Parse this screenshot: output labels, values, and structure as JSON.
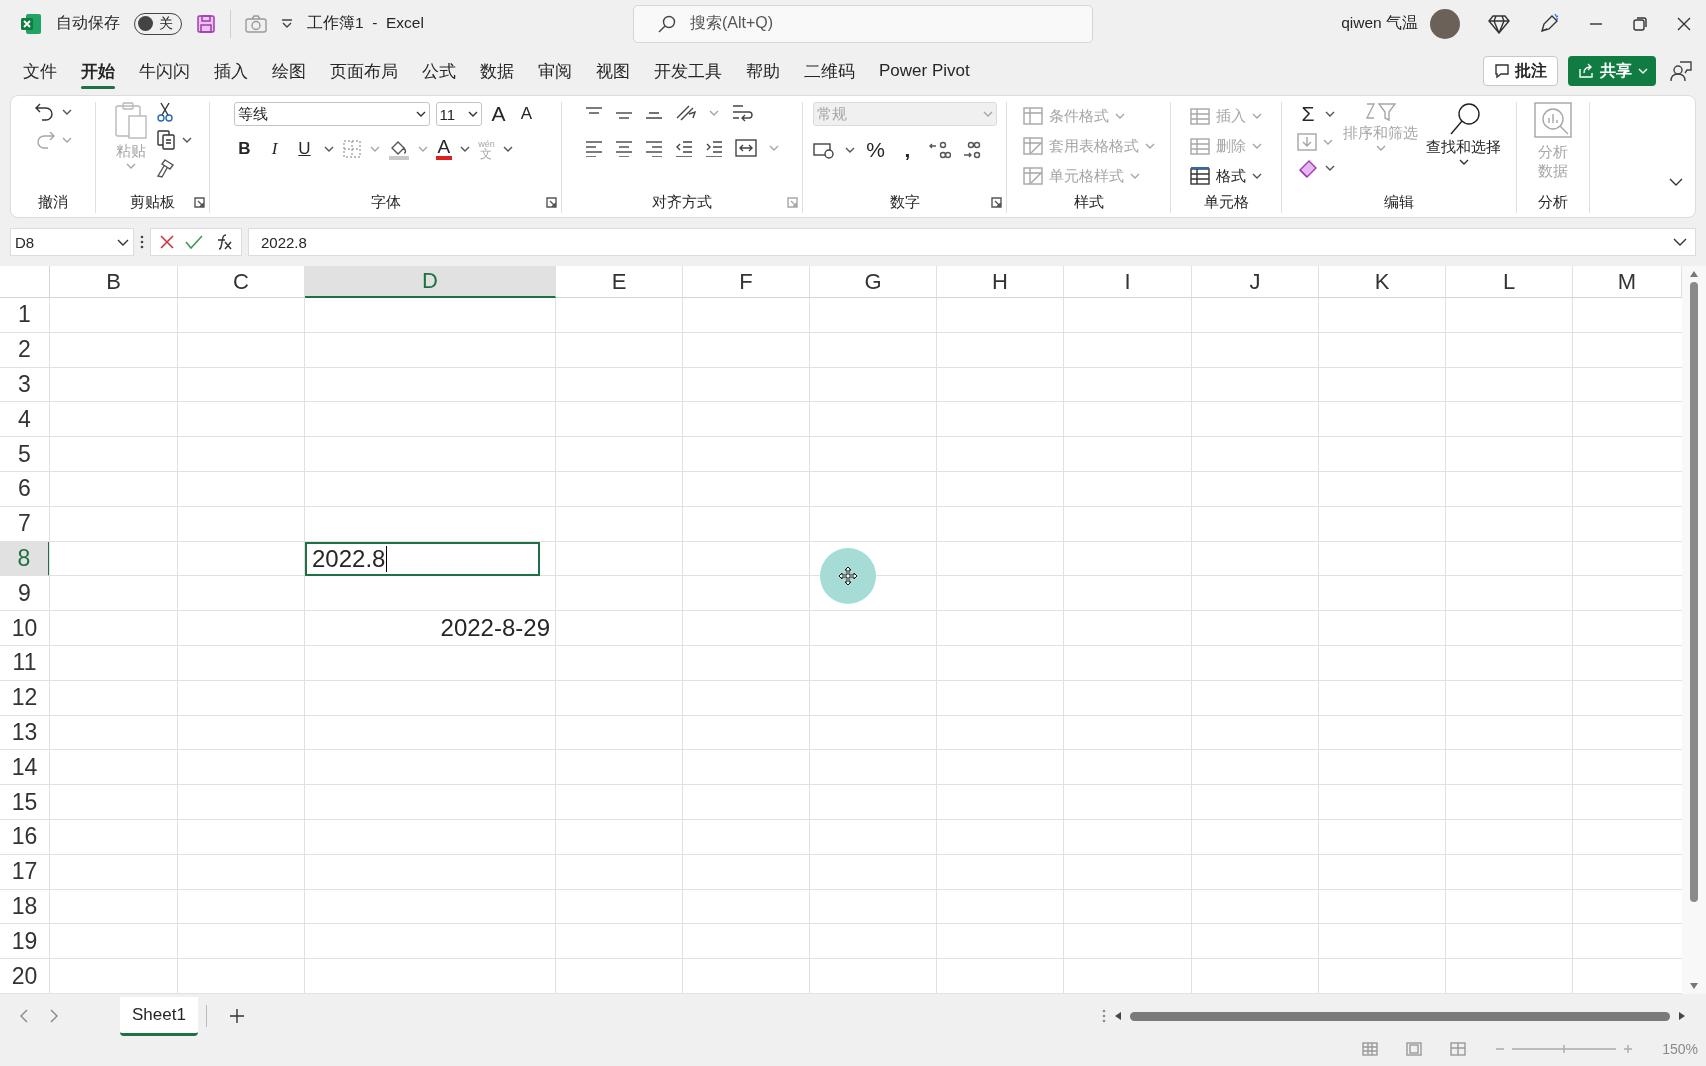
{
  "title_bar": {
    "autosave_label": "自动保存",
    "autosave": {
      "label": "关",
      "on": false
    },
    "document_title": "工作簿1  -  Excel",
    "search": {
      "placeholder": "搜索(Alt+Q)"
    },
    "user_name": "qiwen 气温"
  },
  "ribbon_tabs": [
    {
      "label": "文件",
      "selected": false
    },
    {
      "label": "开始",
      "selected": true
    },
    {
      "label": "牛闪闪",
      "selected": false
    },
    {
      "label": "插入",
      "selected": false
    },
    {
      "label": "绘图",
      "selected": false
    },
    {
      "label": "页面布局",
      "selected": false
    },
    {
      "label": "公式",
      "selected": false
    },
    {
      "label": "数据",
      "selected": false
    },
    {
      "label": "审阅",
      "selected": false
    },
    {
      "label": "视图",
      "selected": false
    },
    {
      "label": "开发工具",
      "selected": false
    },
    {
      "label": "帮助",
      "selected": false
    },
    {
      "label": "二维码",
      "selected": false
    },
    {
      "label": "Power Pivot",
      "selected": false
    }
  ],
  "comments_button": "批注",
  "share_button": "共享",
  "ribbon_groups": [
    {
      "kind": "undo",
      "title": "撤消"
    },
    {
      "kind": "clipboard",
      "title": "剪贴板",
      "launcher": true,
      "paste": {
        "label": "粘贴",
        "disabled": true
      }
    },
    {
      "kind": "font",
      "title": "字体",
      "launcher": true,
      "font_name": "等线",
      "font_size": "11",
      "grow_font": "A",
      "shrink_font": "A",
      "bold": "B",
      "italic": "I",
      "underline": "U",
      "font_color": "A",
      "phonetic": [
        "wén",
        "文"
      ]
    },
    {
      "kind": "alignment",
      "title": "对齐方式",
      "launcher": true
    },
    {
      "kind": "number",
      "title": "数字",
      "launcher": true,
      "number_format": {
        "value": "常规",
        "disabled": true
      },
      "percent": "%",
      "comma": ","
    },
    {
      "kind": "styles",
      "title": "样式",
      "items": [
        {
          "label": "条件格式",
          "disabled": true
        },
        {
          "label": "套用表格格式",
          "disabled": true
        },
        {
          "label": "单元格样式",
          "disabled": true
        }
      ]
    },
    {
      "kind": "cells",
      "title": "单元格",
      "items": [
        {
          "label": "插入",
          "disabled": true
        },
        {
          "label": "删除",
          "disabled": true
        },
        {
          "label": "格式",
          "disabled": false
        }
      ]
    },
    {
      "kind": "editing",
      "title": "编辑",
      "autosum": "Σ",
      "items": [
        {
          "label": "排序和筛选",
          "disabled": true
        },
        {
          "label": "查找和选择",
          "disabled": false
        }
      ]
    },
    {
      "kind": "analysis",
      "title": "分析",
      "items": [
        {
          "label": "分析数据",
          "disabled": true
        }
      ]
    }
  ],
  "formula_bar": {
    "name_box": "D8",
    "formula": "2022.8"
  },
  "sheet": {
    "columns": [
      {
        "label": "B",
        "selected": false
      },
      {
        "label": "C",
        "selected": false
      },
      {
        "label": "D",
        "selected": true
      },
      {
        "label": "E",
        "selected": false
      },
      {
        "label": "F",
        "selected": false
      },
      {
        "label": "G",
        "selected": false
      },
      {
        "label": "H",
        "selected": false
      },
      {
        "label": "I",
        "selected": false
      },
      {
        "label": "J",
        "selected": false
      },
      {
        "label": "K",
        "selected": false
      },
      {
        "label": "L",
        "selected": false
      },
      {
        "label": "M",
        "selected": false
      }
    ],
    "rows": [
      {
        "label": "1",
        "selected": false
      },
      {
        "label": "2",
        "selected": false
      },
      {
        "label": "3",
        "selected": false
      },
      {
        "label": "4",
        "selected": false
      },
      {
        "label": "5",
        "selected": false
      },
      {
        "label": "6",
        "selected": false
      },
      {
        "label": "7",
        "selected": false
      },
      {
        "label": "8",
        "selected": true,
        "cells": [
          null,
          null,
          {
            "value": "2022.8",
            "kind": "editing",
            "active": true
          }
        ]
      },
      {
        "label": "9",
        "selected": false
      },
      {
        "label": "10",
        "selected": false,
        "cells": [
          null,
          null,
          {
            "value": "2022-8-29",
            "kind": "date",
            "active": false
          }
        ]
      },
      {
        "label": "11",
        "selected": false
      },
      {
        "label": "12",
        "selected": false
      },
      {
        "label": "13",
        "selected": false
      },
      {
        "label": "14",
        "selected": false
      },
      {
        "label": "15",
        "selected": false
      },
      {
        "label": "16",
        "selected": false
      },
      {
        "label": "17",
        "selected": false
      },
      {
        "label": "18",
        "selected": false
      },
      {
        "label": "19",
        "selected": false
      },
      {
        "label": "20",
        "selected": false
      }
    ]
  },
  "sheet_tabs": [
    {
      "label": "Sheet1",
      "selected": true
    }
  ],
  "status_bar": {
    "zoom": "150%"
  }
}
